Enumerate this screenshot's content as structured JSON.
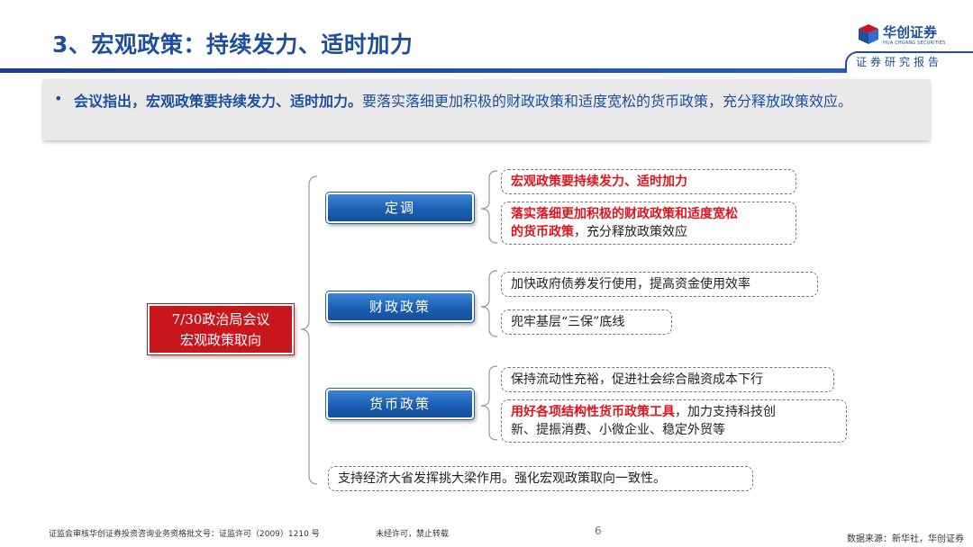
{
  "header": {
    "title": "3、宏观政策：持续发力、适时加力",
    "logo_name": "华创证券",
    "logo_en": "HUA CHUANG SECURITIES",
    "subtitle": "证券研究报告"
  },
  "summary": {
    "bullet": "•",
    "bold_part": "会议指出，宏观政策要持续发力、适时加力。",
    "rest_part": "要落实落细更加积极的财政政策和适度宽松的货币政策，充分释放政策效应。"
  },
  "diagram": {
    "center": {
      "line1": "7/30政治局会议",
      "line2": "宏观政策取向"
    },
    "branches": [
      {
        "label": "定调",
        "items": [
          {
            "red": "宏观政策要持续发力、适时加力",
            "normal": ""
          },
          {
            "red_line1": "落实落细更加积极的财政政策和适度宽松",
            "red_line2": "的货币政策",
            "normal": "，充分释放政策效应"
          }
        ]
      },
      {
        "label": "财政政策",
        "items": [
          {
            "normal": "加快政府债券发行使用，提高资金使用效率"
          },
          {
            "normal": "兜牢基层“三保”底线"
          }
        ]
      },
      {
        "label": "货币政策",
        "items": [
          {
            "normal": "保持流动性充裕，促进社会综合融资成本下行"
          },
          {
            "red": "用好各项结构性货币政策工具",
            "normal_line1": "，加力支持科技创",
            "normal_line2": "新、提振消费、小微企业、稳定外贸等"
          }
        ]
      }
    ],
    "bottom": "支持经济大省发挥挑大梁作用。强化宏观政策取向一致性。"
  },
  "footer": {
    "left": "证监会审核华创证券投资咨询业务资格批文号：证监许可（2009）1210 号",
    "middle": "未经许可，禁止转载",
    "page": "6",
    "right": "数据来源：新华社，华创证券"
  },
  "colors": {
    "brand_blue": "#1f4e9b",
    "accent_red": "#c8161d",
    "highlight_red": "#e0141b"
  }
}
